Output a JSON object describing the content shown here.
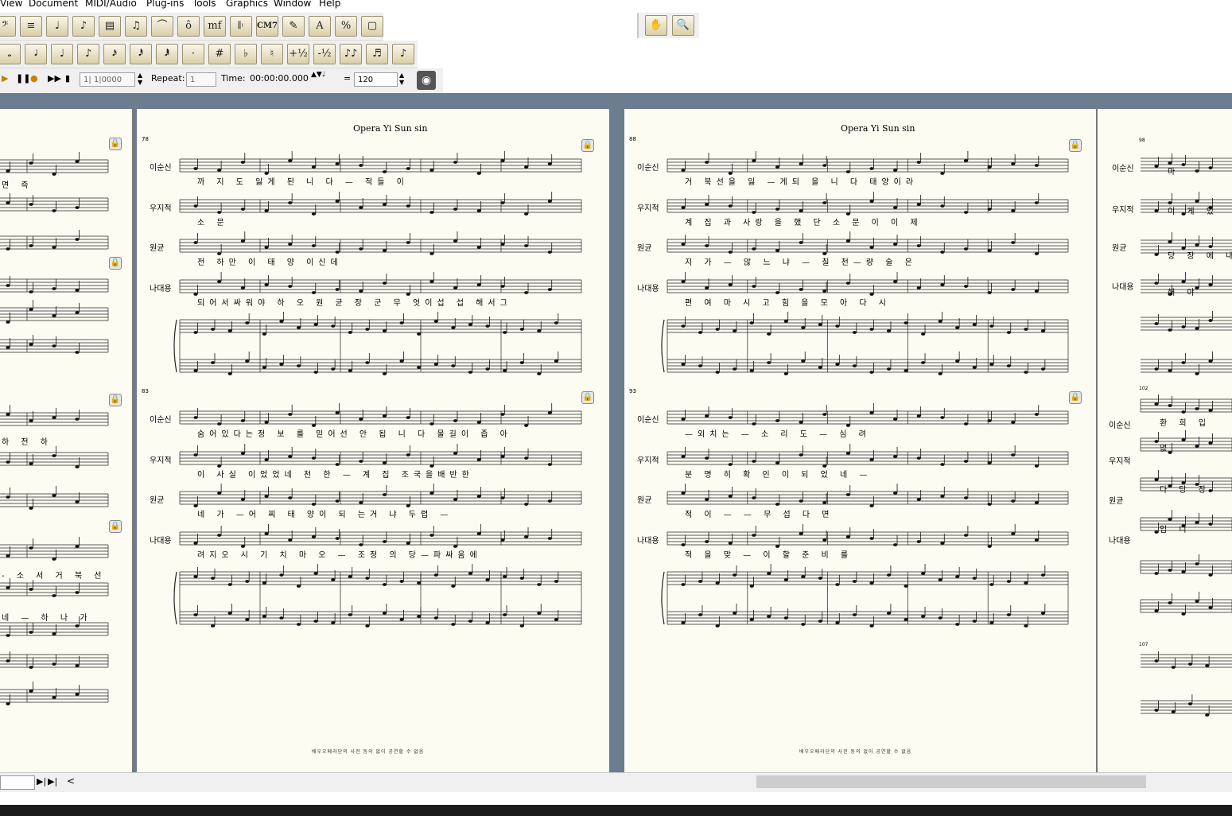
{
  "menu": [
    "View",
    "Document",
    "MIDI/Audio",
    "Plug-ins",
    "Tools",
    "Graphics",
    "Window",
    "Help"
  ],
  "toolbar": {
    "row1": [
      {
        "icon": "bass-clef-icon",
        "glyph": "𝄢"
      },
      {
        "icon": "staff-tool-icon",
        "glyph": "≡"
      },
      {
        "icon": "simple-entry-icon",
        "glyph": "♩"
      },
      {
        "icon": "speedy-entry-icon",
        "glyph": "♪"
      },
      {
        "icon": "layer-icon",
        "glyph": "▤"
      },
      {
        "icon": "tuplet-icon",
        "glyph": "♫"
      },
      {
        "icon": "slur-icon",
        "glyph": "⌒"
      },
      {
        "icon": "articulation-icon",
        "glyph": "ô"
      },
      {
        "icon": "dynamics-icon",
        "glyph": "mf"
      },
      {
        "icon": "repeat-icon",
        "glyph": "𝄆"
      },
      {
        "icon": "chord-icon",
        "glyph": "CM7"
      },
      {
        "icon": "lyrics-icon",
        "glyph": "✎"
      },
      {
        "icon": "text-icon",
        "glyph": "A"
      },
      {
        "icon": "resize-icon",
        "glyph": "%"
      },
      {
        "icon": "page-layout-icon",
        "glyph": "▢"
      }
    ],
    "row2": [
      {
        "icon": "whole-note-icon",
        "glyph": "𝅝"
      },
      {
        "icon": "half-note-icon",
        "glyph": "𝅗𝅥"
      },
      {
        "icon": "quarter-note-icon",
        "glyph": "♩"
      },
      {
        "icon": "eighth-note-icon",
        "glyph": "♪"
      },
      {
        "icon": "sixteenth-note-icon",
        "glyph": "𝅘𝅥𝅯"
      },
      {
        "icon": "32nd-note-icon",
        "glyph": "𝅘𝅥𝅰"
      },
      {
        "icon": "64th-note-icon",
        "glyph": "𝅘𝅥𝅱"
      },
      {
        "icon": "dot-icon",
        "glyph": "·"
      },
      {
        "icon": "sharp-icon",
        "glyph": "#"
      },
      {
        "icon": "flat-icon",
        "glyph": "♭"
      },
      {
        "icon": "natural-icon",
        "glyph": "♮"
      },
      {
        "icon": "half-step-up-icon",
        "glyph": "+½"
      },
      {
        "icon": "half-step-down-icon",
        "glyph": "-½"
      },
      {
        "icon": "tie-icon",
        "glyph": "♪♪"
      },
      {
        "icon": "tuplet-entry-icon",
        "glyph": "♬"
      },
      {
        "icon": "grace-note-icon",
        "glyph": "♪"
      }
    ],
    "right": [
      {
        "icon": "hand-grabber-icon",
        "glyph": "✋"
      },
      {
        "icon": "zoom-icon",
        "glyph": "🔍"
      }
    ]
  },
  "playback": {
    "counter": "1| 1|0000",
    "repeat_label": "Repeat:",
    "repeat_value": "1",
    "time_label": "Time:",
    "time_value": "00:00:00.000",
    "equals": "=",
    "tempo": "120"
  },
  "pages": [
    {
      "title": "Opera Yi Sun sin",
      "system1_measure": "78",
      "system2_measure": "83",
      "staff_names": [
        "이순신",
        "우지적",
        "원균",
        "나대용"
      ],
      "lyrics1": [
        "까 지 도 잃게 된 니 다 — 적들 이",
        "소 문",
        "전 하만 이 태 양 이신데",
        "되어서싸워야 하 오 원 균 장 군 무 엇이섭 섭 해서그"
      ],
      "lyrics2": [
        "숨어있다는정 보 를 믿어선 안 됩 니 다 물길이 좁 아",
        "이 사실 이었었네 천 한 — 계 집 조국을배반한",
        "네 가 —어 찌 태 양이 되 는거 냐 두렵 —",
        "려지오 시 기 치 마 오 — 조정 의 당—파싸움에"
      ],
      "footer": "배우오페라단의 사전 동의 없이 공연할 수 없음"
    },
    {
      "title": "Opera Yi Sun sin",
      "system1_measure": "88",
      "system2_measure": "93",
      "staff_names": [
        "이순신",
        "우지적",
        "원균",
        "나대용"
      ],
      "lyrics1": [
        "거 북선을 잃 —게되 을 니 다 태양이라",
        "계 집 과 사랑 을 했 단 소 문 이 이 제",
        "지 가 — 않 느 냐 — 칠 천—량 술 은",
        "편 여 마 시 고 힘 을 모 아 다 시"
      ],
      "lyrics2": [
        "—외치는 — 소 리 도 — 심 려",
        "분 명 히 확 인 이 되 었 네 —",
        "적 이 — — 무 섭 다 면",
        "적 을 맞 — 이 할 준 비 를"
      ],
      "footer": "배우오페라단의 사전 동의 없이 공연할 수 없음"
    }
  ],
  "right_page": {
    "staff_names1": [
      "이순신",
      "우지적",
      "원균",
      "나대용"
    ],
    "staff_names2": [
      "이순신",
      "우지적",
      "원균",
      "나대용"
    ],
    "lyrics1": [
      "마",
      "이 게 있",
      "당 장 에 내",
      "해 야"
    ],
    "lyrics2": [
      "환 희 입",
      "없 ",
      "다 당 장",
      "입 니"
    ],
    "measures": [
      "98",
      "102",
      "107"
    ]
  },
  "left_page": {
    "lyrics": [
      "면 즉",
      "하 전 하",
      "- 소 서 거 북 선",
      "네 — 하 나 가"
    ]
  }
}
